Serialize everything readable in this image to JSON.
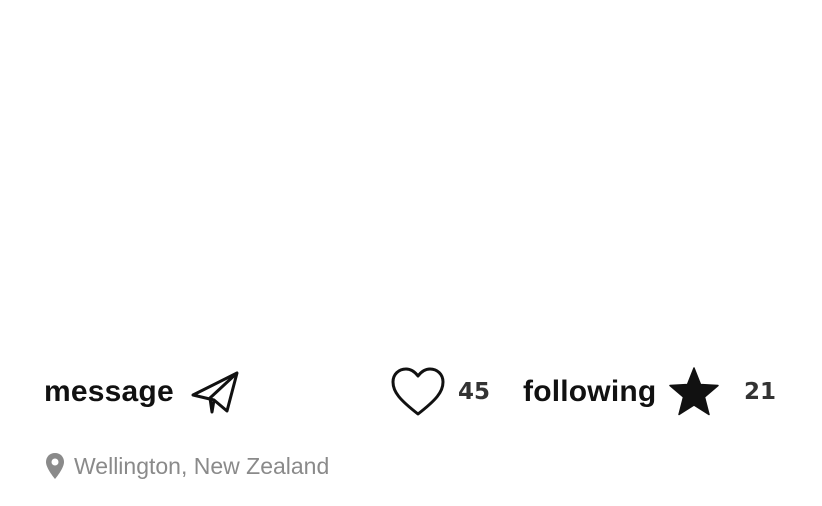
{
  "actions": {
    "message_label": "message",
    "message_icon": "paper-plane-icon",
    "like_icon": "heart-outline-icon",
    "like_count": "45",
    "following_label": "following",
    "following_icon": "star-filled-icon",
    "following_count": "21"
  },
  "location": {
    "icon": "location-pin-icon",
    "text": "Wellington, New Zealand"
  },
  "colors": {
    "text_primary": "#111111",
    "count_text": "#333333",
    "location_text": "#8a8a8a",
    "background": "#ffffff"
  }
}
